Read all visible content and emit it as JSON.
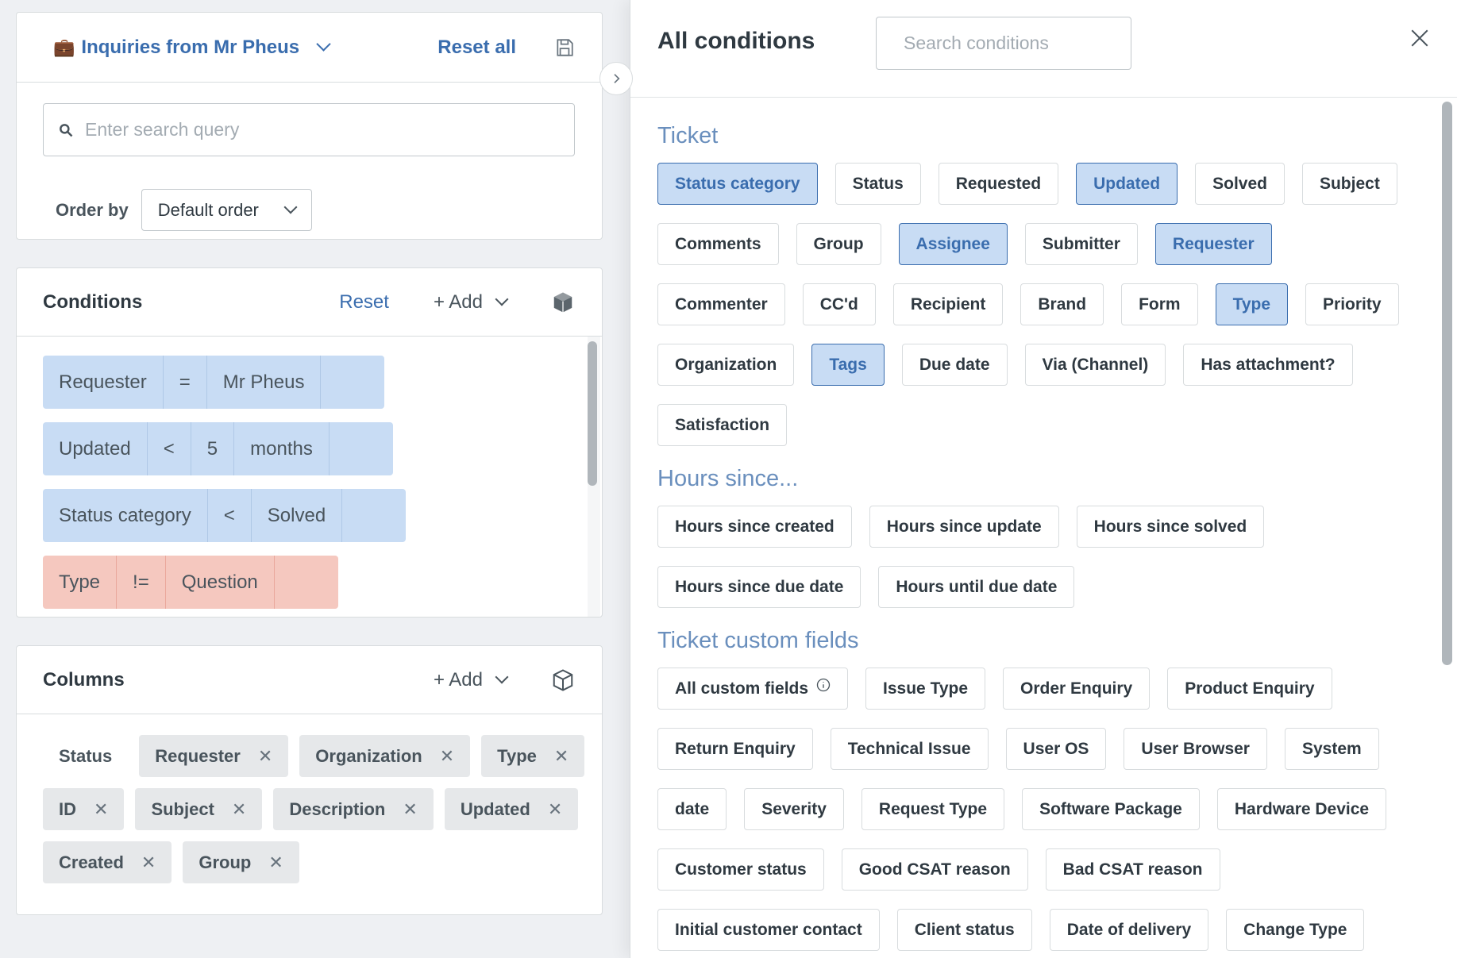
{
  "view": {
    "title": "Inquiries from Mr Pheus",
    "reset_all_label": "Reset all",
    "search_placeholder": "Enter search query",
    "order_by_label": "Order by",
    "order_by_value": "Default order"
  },
  "conditions": {
    "title": "Conditions",
    "reset_label": "Reset",
    "add_label": "+ Add",
    "items": [
      {
        "field": "Requester",
        "op": "=",
        "value": "Mr Pheus",
        "unit": ""
      },
      {
        "field": "Updated",
        "op": "<",
        "value": "5",
        "unit": "months"
      },
      {
        "field": "Status category",
        "op": "<",
        "value": "Solved",
        "unit": ""
      },
      {
        "field": "Type",
        "op": "!=",
        "value": "Question",
        "unit": ""
      }
    ]
  },
  "columns": {
    "title": "Columns",
    "add_label": "+ Add",
    "fixed": "Status",
    "items": [
      "Requester",
      "Organization",
      "Type",
      "ID",
      "Subject",
      "Description",
      "Updated",
      "Created",
      "Group"
    ]
  },
  "all_conditions": {
    "title": "All conditions",
    "search_placeholder": "Search conditions",
    "sections": [
      {
        "title": "Ticket",
        "chips": [
          {
            "label": "Status category",
            "selected": true
          },
          {
            "label": "Status",
            "selected": false
          },
          {
            "label": "Requested",
            "selected": false
          },
          {
            "label": "Updated",
            "selected": true
          },
          {
            "label": "Solved",
            "selected": false
          },
          {
            "label": "Subject",
            "selected": false
          },
          {
            "label": "Comments",
            "selected": false
          },
          {
            "label": "Group",
            "selected": false
          },
          {
            "label": "Assignee",
            "selected": true
          },
          {
            "label": "Submitter",
            "selected": false
          },
          {
            "label": "Requester",
            "selected": true
          },
          {
            "label": "Commenter",
            "selected": false
          },
          {
            "label": "CC'd",
            "selected": false
          },
          {
            "label": "Recipient",
            "selected": false
          },
          {
            "label": "Brand",
            "selected": false
          },
          {
            "label": "Form",
            "selected": false
          },
          {
            "label": "Type",
            "selected": true
          },
          {
            "label": "Priority",
            "selected": false
          },
          {
            "label": "Organization",
            "selected": false
          },
          {
            "label": "Tags",
            "selected": true
          },
          {
            "label": "Due date",
            "selected": false
          },
          {
            "label": "Via (Channel)",
            "selected": false
          },
          {
            "label": "Has attachment?",
            "selected": false
          },
          {
            "label": "Satisfaction",
            "selected": false
          }
        ]
      },
      {
        "title": "Hours since...",
        "chips": [
          {
            "label": "Hours since created",
            "selected": false
          },
          {
            "label": "Hours since update",
            "selected": false
          },
          {
            "label": "Hours since solved",
            "selected": false
          },
          {
            "label": "Hours since due date",
            "selected": false
          },
          {
            "label": "Hours until due date",
            "selected": false
          }
        ]
      },
      {
        "title": "Ticket custom fields",
        "chips": [
          {
            "label": "All custom fields",
            "selected": false,
            "info": true
          },
          {
            "label": "Issue Type",
            "selected": false
          },
          {
            "label": "Order Enquiry",
            "selected": false
          },
          {
            "label": "Product Enquiry",
            "selected": false
          },
          {
            "label": "Return Enquiry",
            "selected": false
          },
          {
            "label": "Technical Issue",
            "selected": false
          },
          {
            "label": "User OS",
            "selected": false
          },
          {
            "label": "User Browser",
            "selected": false
          },
          {
            "label": "System",
            "selected": false
          },
          {
            "label": "date",
            "selected": false
          },
          {
            "label": "Severity",
            "selected": false
          },
          {
            "label": "Request Type",
            "selected": false
          },
          {
            "label": "Software Package",
            "selected": false
          },
          {
            "label": "Hardware Device",
            "selected": false
          },
          {
            "label": "Customer status",
            "selected": false
          },
          {
            "label": "Good CSAT reason",
            "selected": false
          },
          {
            "label": "Bad CSAT reason",
            "selected": false
          },
          {
            "label": "Initial customer contact",
            "selected": false
          },
          {
            "label": "Client status",
            "selected": false
          },
          {
            "label": "Date of delivery",
            "selected": false
          },
          {
            "label": "Change Type",
            "selected": false
          }
        ]
      }
    ]
  },
  "colors": {
    "accent": "#3a6dae",
    "condition_bg": "#c8dcf4",
    "negative_condition_bg": "#f5c8bf",
    "section_title": "#6a8fbd"
  }
}
